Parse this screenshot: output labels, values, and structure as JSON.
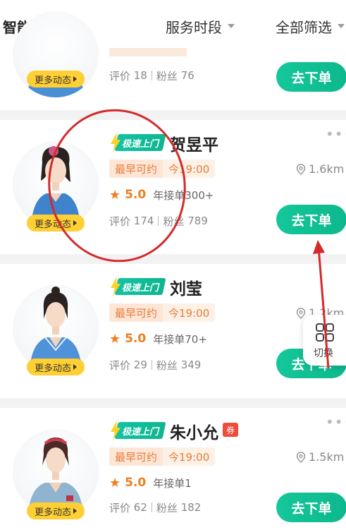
{
  "filter_bar": {
    "sort": "智能排序",
    "service_time": "服务时段",
    "all_filters": "全部筛选"
  },
  "common": {
    "more_label": "更多动态",
    "speed_badge": "极速上门",
    "earliest_label": "最早可约",
    "order_button": "去下单",
    "rating_label": "评价",
    "fans_label": "粉丝"
  },
  "cards": [
    {
      "name": "",
      "rating_count": "18",
      "fans": "76"
    },
    {
      "name": "贺昱平",
      "earliest_time": "今19:00",
      "score": "5.0",
      "orders": "年接单300+",
      "rating_count": "174",
      "fans": "789",
      "distance": "1.6km"
    },
    {
      "name": "刘莹",
      "earliest_time": "今19:00",
      "score": "5.0",
      "orders": "年接单70+",
      "rating_count": "29",
      "fans": "349",
      "distance": "1.2km"
    },
    {
      "name": "朱小允",
      "coupon": "券",
      "earliest_time": "今19:00",
      "score": "5.0",
      "orders": "年接单1",
      "rating_count": "62",
      "fans": "182",
      "distance": "1.5km"
    }
  ],
  "switch_fab": {
    "label": "切换"
  },
  "colors": {
    "accent_green": "#12c39a",
    "more_yellow": "#ffcf33",
    "rating_orange": "#f07d1e",
    "annotation_red": "#d42a2a"
  }
}
